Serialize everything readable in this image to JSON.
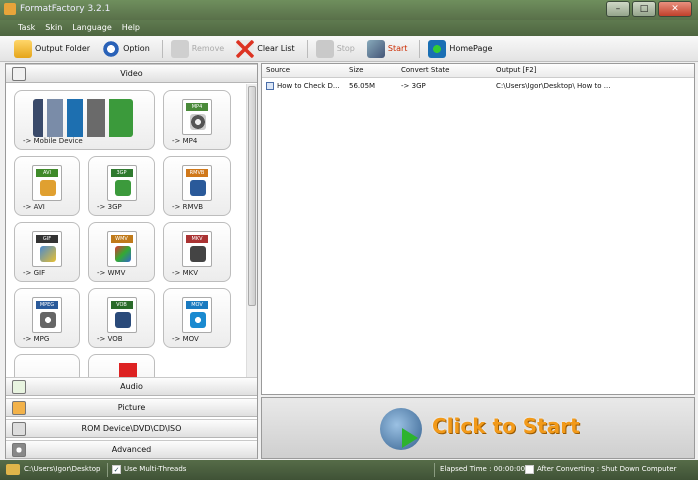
{
  "window": {
    "title": "FormatFactory 3.2.1",
    "controls": {
      "minimize": "–",
      "maximize": "□",
      "close": "✕"
    }
  },
  "menu": [
    "Task",
    "Skin",
    "Language",
    "Help"
  ],
  "toolbar": {
    "output_folder": "Output Folder",
    "option": "Option",
    "remove": "Remove",
    "clear_list": "Clear List",
    "stop": "Stop",
    "start": "Start",
    "homepage": "HomePage"
  },
  "categories": {
    "video": "Video",
    "audio": "Audio",
    "picture": "Picture",
    "rom": "ROM Device\\DVD\\CD\\ISO",
    "advanced": "Advanced"
  },
  "video_tiles": [
    {
      "label": "-> Mobile Device"
    },
    {
      "label": "-> MP4",
      "tag": "MP4"
    },
    {
      "label": "-> AVI",
      "tag": "AVI"
    },
    {
      "label": "-> 3GP",
      "tag": "3GP"
    },
    {
      "label": "-> RMVB",
      "tag": "RMVB"
    },
    {
      "label": "-> GIF",
      "tag": "GIF"
    },
    {
      "label": "-> WMV",
      "tag": "WMV"
    },
    {
      "label": "-> MKV",
      "tag": "MKV"
    },
    {
      "label": "-> MPG",
      "tag": "MPEG"
    },
    {
      "label": "-> VOB",
      "tag": "VOB"
    },
    {
      "label": "-> MOV",
      "tag": "MOV"
    }
  ],
  "table": {
    "columns": [
      "Source",
      "Size",
      "Convert State",
      "Output [F2]"
    ],
    "rows": [
      {
        "source": "How to Check D...",
        "size": "56.05M",
        "state": "-> 3GP",
        "output": "C:\\Users\\Igor\\Desktop\\ How to ..."
      }
    ]
  },
  "start_button": "Click to Start",
  "statusbar": {
    "path": "C:\\Users\\Igor\\Desktop",
    "multithreads": "Use Multi-Threads",
    "elapsed": "Elapsed Time : 00:00:00",
    "after": "After Converting : Shut Down Computer"
  },
  "colors": {
    "accent_start": "#f29a1a",
    "titlebar": "#5f7a4f"
  }
}
